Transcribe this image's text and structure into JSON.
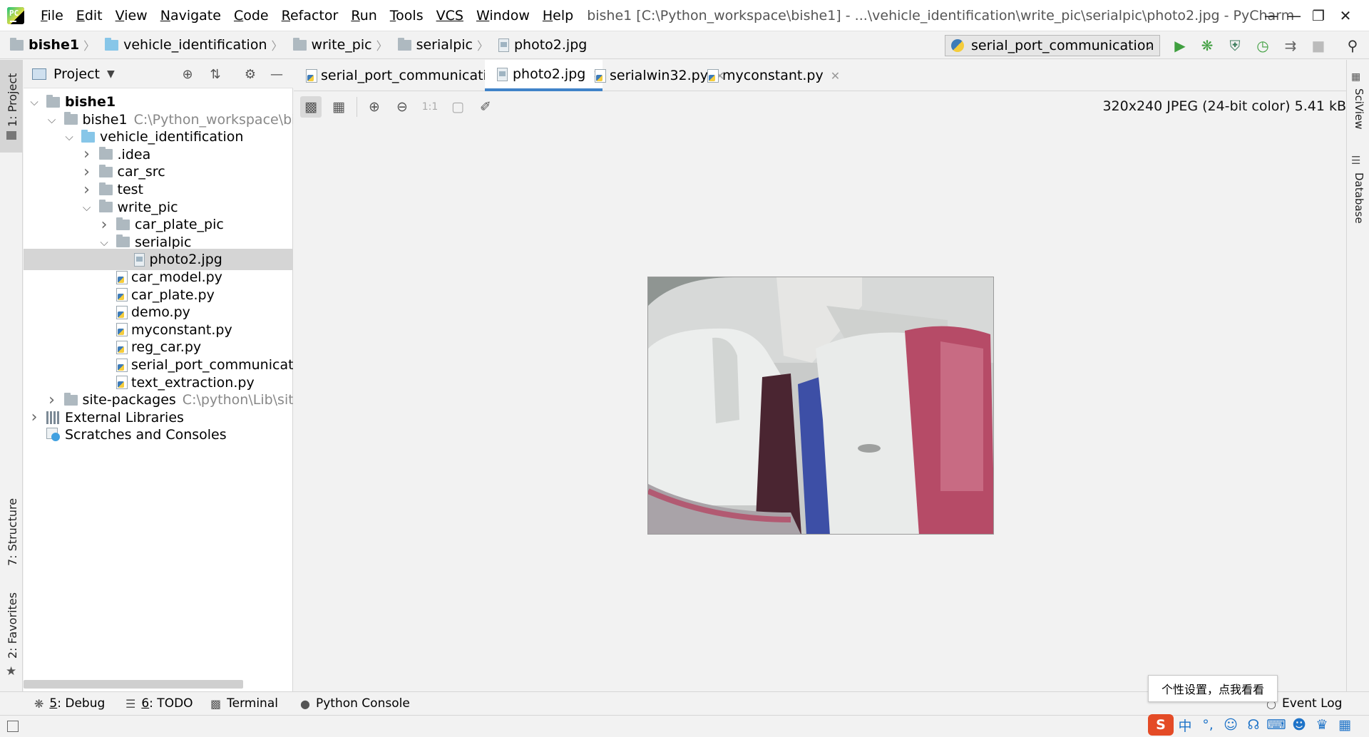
{
  "menu": {
    "items": [
      {
        "mn": "F",
        "rest": "ile"
      },
      {
        "mn": "E",
        "rest": "dit"
      },
      {
        "mn": "V",
        "rest": "iew"
      },
      {
        "mn": "N",
        "rest": "avigate"
      },
      {
        "mn": "C",
        "rest": "ode"
      },
      {
        "mn": "R",
        "rest": "efactor"
      },
      {
        "mn": "R",
        "rest": "un"
      },
      {
        "mn": "T",
        "rest": "ools"
      },
      {
        "mn": "VCS",
        "rest": ""
      },
      {
        "mn": "W",
        "rest": "indow"
      },
      {
        "mn": "H",
        "rest": "elp"
      }
    ]
  },
  "window": {
    "title": "bishe1 [C:\\Python_workspace\\bishe1] - ...\\vehicle_identification\\write_pic\\serialpic\\photo2.jpg - PyCharm"
  },
  "breadcrumb": [
    "bishe1",
    "vehicle_identification",
    "write_pic",
    "serialpic",
    "photo2.jpg"
  ],
  "run_config": "serial_port_communication",
  "left_strip": {
    "project": "1: Project",
    "structure": "7: Structure",
    "favorites": "2: Favorites"
  },
  "right_strip": {
    "sciview": "SciView",
    "database": "Database"
  },
  "project_panel": {
    "title": "Project",
    "tree": [
      {
        "label": "bishe1",
        "hint": "",
        "type": "project",
        "arrow": "open"
      },
      {
        "label": "bishe1",
        "hint": "C:\\Python_workspace\\bish",
        "type": "folder",
        "arrow": "open"
      },
      {
        "label": "vehicle_identification",
        "hint": "",
        "type": "folder-blue",
        "arrow": "open"
      },
      {
        "label": ".idea",
        "hint": "",
        "type": "folder",
        "arrow": "closed"
      },
      {
        "label": "car_src",
        "hint": "",
        "type": "folder",
        "arrow": "closed"
      },
      {
        "label": "test",
        "hint": "",
        "type": "folder",
        "arrow": "closed"
      },
      {
        "label": "write_pic",
        "hint": "",
        "type": "folder",
        "arrow": "open"
      },
      {
        "label": "car_plate_pic",
        "hint": "",
        "type": "folder",
        "arrow": "closed"
      },
      {
        "label": "serialpic",
        "hint": "",
        "type": "folder",
        "arrow": "open"
      },
      {
        "label": "photo2.jpg",
        "hint": "",
        "type": "image",
        "arrow": "none"
      },
      {
        "label": "car_model.py",
        "hint": "",
        "type": "python",
        "arrow": "none"
      },
      {
        "label": "car_plate.py",
        "hint": "",
        "type": "python",
        "arrow": "none"
      },
      {
        "label": "demo.py",
        "hint": "",
        "type": "python",
        "arrow": "none"
      },
      {
        "label": "myconstant.py",
        "hint": "",
        "type": "python",
        "arrow": "none"
      },
      {
        "label": "reg_car.py",
        "hint": "",
        "type": "python",
        "arrow": "none"
      },
      {
        "label": "serial_port_communication",
        "hint": "",
        "type": "python",
        "arrow": "none"
      },
      {
        "label": "text_extraction.py",
        "hint": "",
        "type": "python",
        "arrow": "none"
      },
      {
        "label": "site-packages",
        "hint": "C:\\python\\Lib\\site-",
        "type": "folder",
        "arrow": "closed"
      },
      {
        "label": "External Libraries",
        "hint": "",
        "type": "library",
        "arrow": "closed"
      },
      {
        "label": "Scratches and Consoles",
        "hint": "",
        "type": "scratch",
        "arrow": "none"
      }
    ]
  },
  "editor": {
    "tabs": [
      {
        "label": "serial_port_communication.py",
        "type": "python",
        "active": false
      },
      {
        "label": "photo2.jpg",
        "type": "image",
        "active": true
      },
      {
        "label": "serialwin32.py",
        "type": "python",
        "active": false
      },
      {
        "label": "myconstant.py",
        "type": "python",
        "active": false
      }
    ],
    "image_info": "320x240 JPEG (24-bit color) 5.41 kB",
    "zoom_actual_label": "1:1"
  },
  "bottom_bar": {
    "debug": {
      "mn": "5",
      "rest": ": Debug"
    },
    "todo": {
      "mn": "6",
      "rest": ": TODO"
    },
    "terminal": "Terminal",
    "python_console": "Python Console",
    "event_log": "Event Log"
  },
  "ime": {
    "tooltip": "个性设置，点我看看",
    "mode": "中"
  },
  "colors": {
    "accent": "#4083c9",
    "selection": "#d5d5d5",
    "run_green": "#3f9f3f"
  }
}
